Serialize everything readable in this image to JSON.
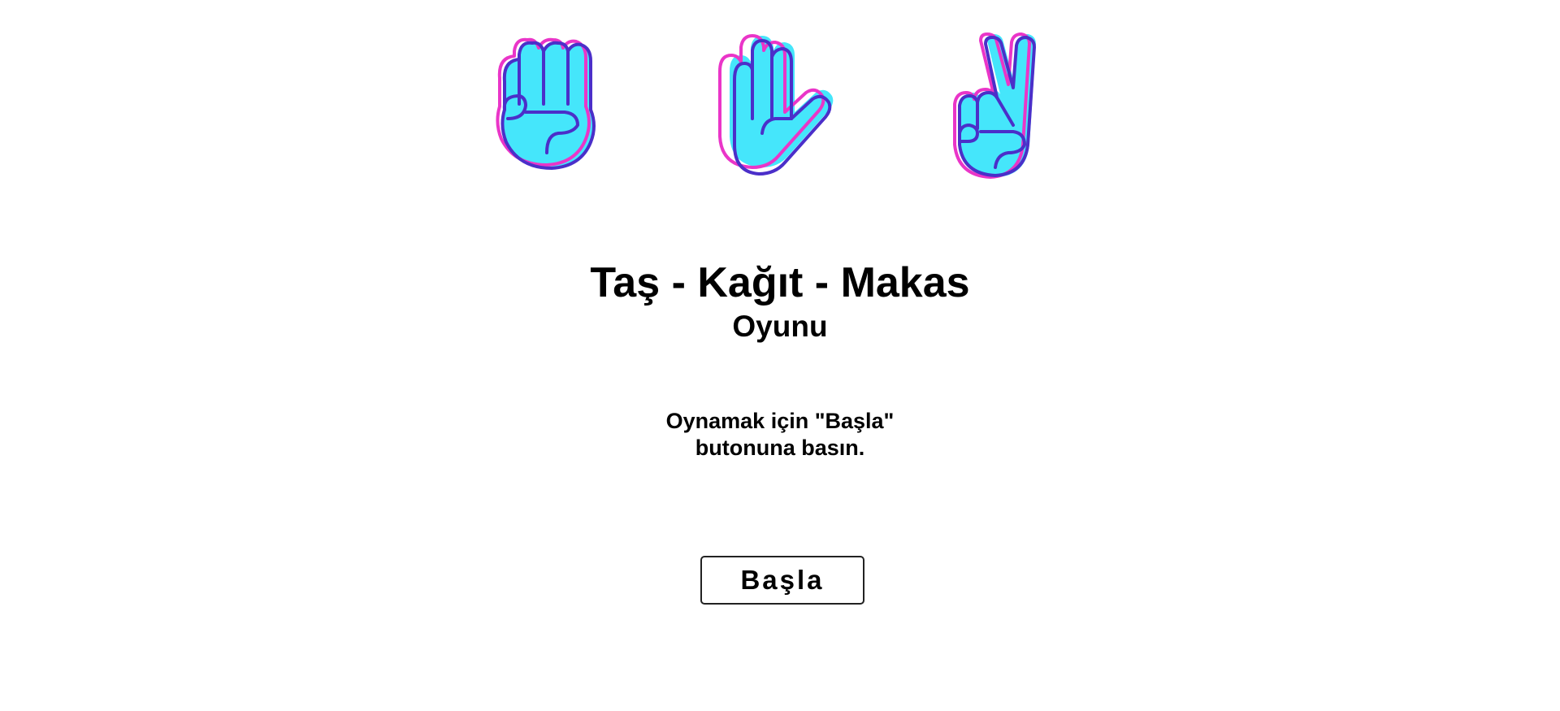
{
  "hands": {
    "rock_icon": "rock-fist-icon",
    "paper_icon": "paper-open-hand-icon",
    "scissors_icon": "scissors-victory-hand-icon",
    "colors": {
      "fill": "#45e6fb",
      "outline": "#4b2fc9",
      "shadow_outline": "#ea35c8"
    }
  },
  "header": {
    "title": "Taş - Kağıt - Makas",
    "subtitle": "Oyunu"
  },
  "instructions": {
    "line1": "Oynamak için \"Başla\"",
    "line2": "butonuna basın."
  },
  "controls": {
    "start_label": "Başla"
  }
}
